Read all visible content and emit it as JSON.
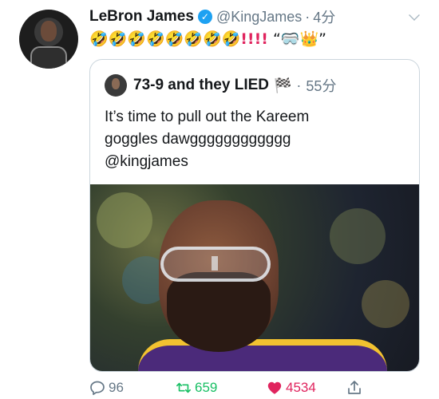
{
  "author": {
    "name": "LeBron James",
    "handle": "@KingJames",
    "dot": "·",
    "time": "4分",
    "verified_icon": "verified-badge-icon"
  },
  "tweet": {
    "emojis": "🤣🤣🤣🤣🤣🤣🤣🤣",
    "bangs": "!!!!",
    "tail": " “🥽👑”"
  },
  "quoted": {
    "name": "73-9 and they LIED",
    "flag": "🏁",
    "dot": "·",
    "time": "55分",
    "lines": [
      "It’s time to pull out the Kareem",
      "goggles dawgggggggggggg",
      "@kingjames"
    ]
  },
  "actions": {
    "reply_count": "96",
    "retweet_count": "659",
    "like_count": "4534"
  },
  "colors": {
    "accent": "#1da1f2",
    "like": "#e0245e",
    "retweet": "#17bf63",
    "muted": "#657786"
  }
}
